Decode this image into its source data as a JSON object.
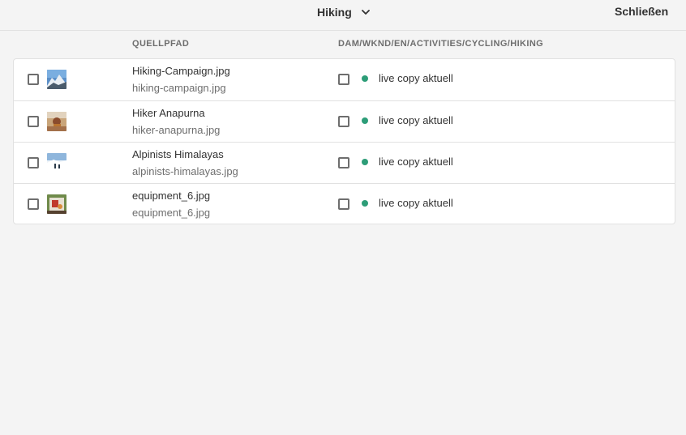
{
  "header": {
    "view_select_label": "Hiking",
    "close_label": "Schließen"
  },
  "columns": {
    "source": "QUELLPFAD",
    "target": "DAM/WKND/EN/ACTIVITIES/CYCLING/HIKING"
  },
  "colors": {
    "status_ok": "#2d9d78",
    "background": "#f4f4f4"
  },
  "rows": [
    {
      "title": "Hiking-Campaign.jpg",
      "filename": "hiking-campaign.jpg",
      "status": "live copy aktuell",
      "thumbnail": "mountain-photo"
    },
    {
      "title": "Hiker Anapurna",
      "filename": "hiker-anapurna.jpg",
      "status": "live copy aktuell",
      "thumbnail": "hiker-photo"
    },
    {
      "title": "Alpinists Himalayas",
      "filename": "alpinists-himalayas.jpg",
      "status": "live copy aktuell",
      "thumbnail": "snow-photo"
    },
    {
      "title": "equipment_6.jpg",
      "filename": "equipment_6.jpg",
      "status": "live copy aktuell",
      "thumbnail": "equipment-photo"
    }
  ]
}
